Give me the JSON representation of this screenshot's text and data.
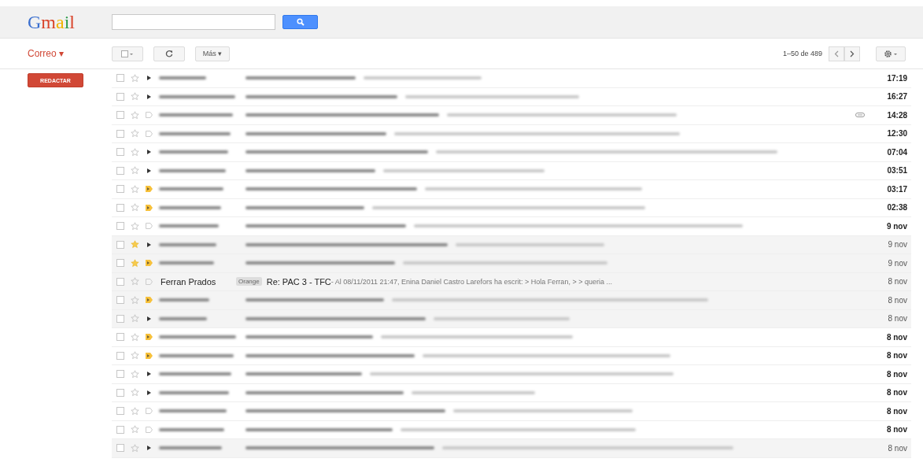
{
  "header": {
    "logo": "Gmail"
  },
  "toolbar": {
    "mail_menu": "Correo ▾",
    "more_button": "Más ▾",
    "pagination": "1–50 de 489"
  },
  "sidebar": {
    "compose_button": "REDACTAR"
  },
  "messages": [
    {
      "time": "17:19",
      "unread": true,
      "starred": false,
      "kind": "arrow",
      "attachment": false
    },
    {
      "time": "16:27",
      "unread": true,
      "starred": false,
      "kind": "arrow",
      "attachment": false
    },
    {
      "time": "14:28",
      "unread": true,
      "starred": false,
      "kind": "outline",
      "attachment": true
    },
    {
      "time": "12:30",
      "unread": true,
      "starred": false,
      "kind": "outline",
      "attachment": false
    },
    {
      "time": "07:04",
      "unread": true,
      "starred": false,
      "kind": "arrow",
      "attachment": false
    },
    {
      "time": "03:51",
      "unread": true,
      "starred": false,
      "kind": "arrow",
      "attachment": false
    },
    {
      "time": "03:17",
      "unread": true,
      "starred": false,
      "kind": "important",
      "attachment": false
    },
    {
      "time": "02:38",
      "unread": true,
      "starred": false,
      "kind": "important",
      "attachment": false
    },
    {
      "time": "9 nov",
      "unread": true,
      "starred": false,
      "kind": "outline",
      "attachment": false
    },
    {
      "time": "9 nov",
      "unread": false,
      "starred": true,
      "kind": "arrow",
      "attachment": false
    },
    {
      "time": "9 nov",
      "unread": false,
      "starred": true,
      "kind": "important",
      "attachment": false
    },
    {
      "time": "8 nov",
      "unread": false,
      "starred": false,
      "kind": "outline",
      "attachment": false,
      "sender": "Ferran Prados",
      "label": "Orange",
      "subject": "Re: PAC 3 - TFC",
      "snippet": " - Al 08/11/2011 21:47, Enina Daniel Castro Larefors ha escrit: > Hola Ferran, > > queria ..."
    },
    {
      "time": "8 nov",
      "unread": false,
      "starred": false,
      "kind": "important",
      "attachment": false
    },
    {
      "time": "8 nov",
      "unread": false,
      "starred": false,
      "kind": "arrow",
      "attachment": false
    },
    {
      "time": "8 nov",
      "unread": true,
      "starred": false,
      "kind": "important",
      "attachment": false
    },
    {
      "time": "8 nov",
      "unread": true,
      "starred": false,
      "kind": "important",
      "attachment": false
    },
    {
      "time": "8 nov",
      "unread": true,
      "starred": false,
      "kind": "arrow",
      "attachment": false
    },
    {
      "time": "8 nov",
      "unread": true,
      "starred": false,
      "kind": "arrow",
      "attachment": false
    },
    {
      "time": "8 nov",
      "unread": true,
      "starred": false,
      "kind": "outline",
      "attachment": false
    },
    {
      "time": "8 nov",
      "unread": true,
      "starred": false,
      "kind": "outline",
      "attachment": false
    },
    {
      "time": "8 nov",
      "unread": false,
      "starred": false,
      "kind": "arrow",
      "attachment": false
    }
  ]
}
